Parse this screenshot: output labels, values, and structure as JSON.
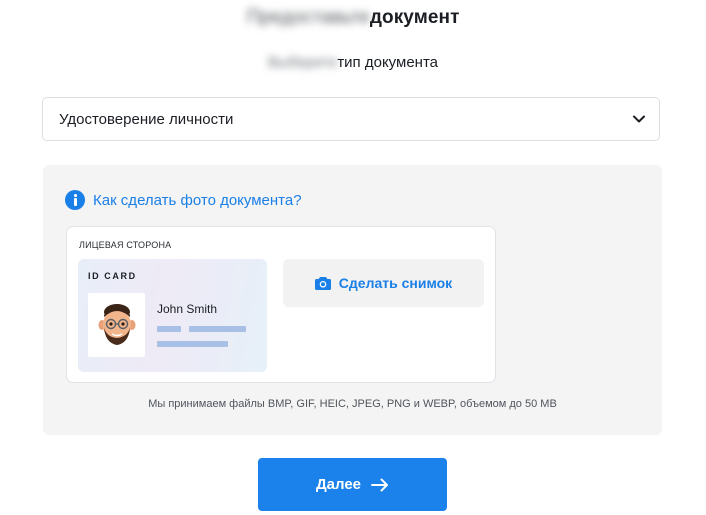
{
  "header": {
    "title_blurred": "Предоставьте",
    "title": "документ",
    "subtitle_blurred": "Выберите",
    "subtitle": "тип документа"
  },
  "document_type": {
    "selected": "Удостоверение личности",
    "chevron_icon": "chevron-down-icon"
  },
  "upload_panel": {
    "howto_link": "Как сделать фото документа?",
    "howto_icon": "info-icon",
    "side_label": "ЛИЦЕВАЯ СТОРОНА",
    "sample_card": {
      "title": "ID CARD",
      "name": "John Smith"
    },
    "snapshot_button": "Сделать снимок",
    "snapshot_icon": "camera-icon",
    "formats_note": "Мы принимаем файлы BMP, GIF, HEIC, JPEG, PNG и WEBP, объемом до 50 MB"
  },
  "footer": {
    "next_button": "Далее",
    "next_icon": "arrow-right-icon"
  },
  "colors": {
    "accent": "#1a82ea",
    "link": "#1a7fe6",
    "panel_bg": "#f4f4f5"
  }
}
